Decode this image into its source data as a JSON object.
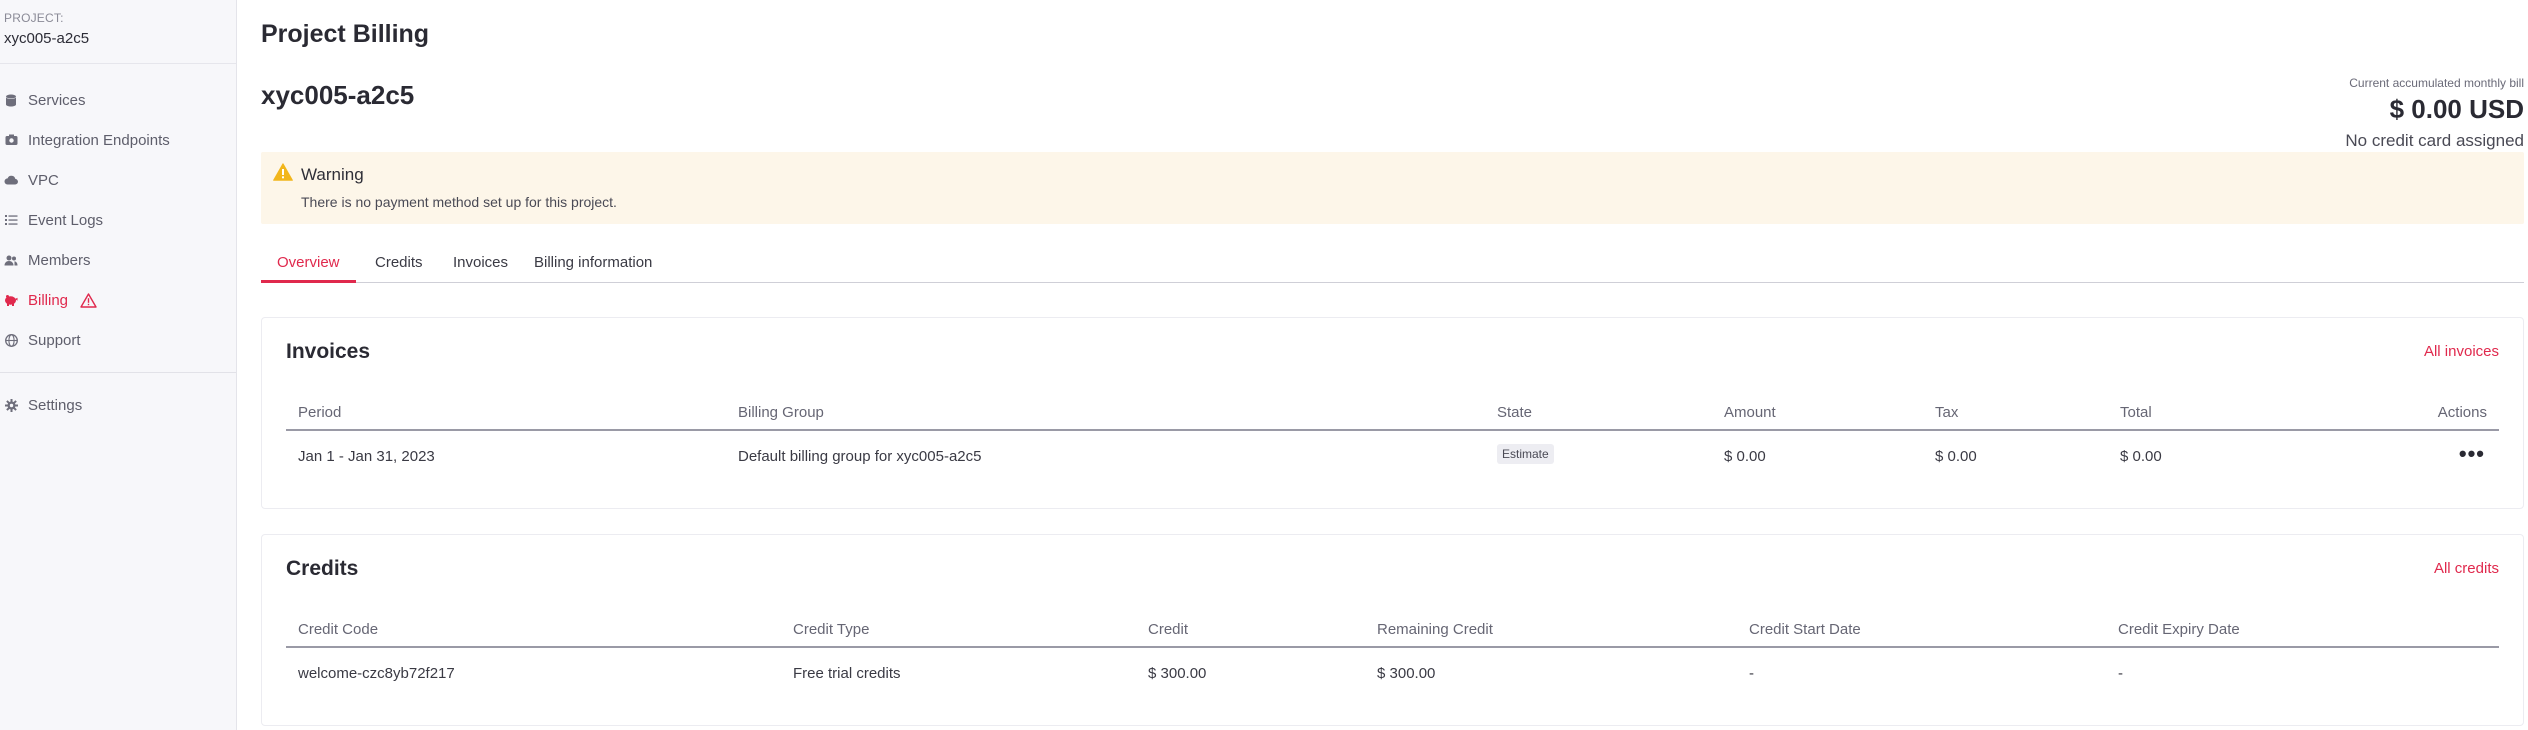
{
  "sidebar": {
    "project_caption": "PROJECT:",
    "project_name": "xyc005-a2c5",
    "items": [
      {
        "label": "Services",
        "icon": "database-icon"
      },
      {
        "label": "Integration Endpoints",
        "icon": "camera-icon"
      },
      {
        "label": "VPC",
        "icon": "cloud-icon"
      },
      {
        "label": "Event Logs",
        "icon": "list-icon"
      },
      {
        "label": "Members",
        "icon": "users-icon"
      },
      {
        "label": "Billing",
        "icon": "piggy-bank-icon",
        "active": true,
        "alert": "warning-triangle-icon"
      },
      {
        "label": "Support",
        "icon": "globe-icon"
      }
    ],
    "settings_label": "Settings"
  },
  "header": {
    "page_title": "Project Billing",
    "project_heading": "xyc005-a2c5"
  },
  "bill": {
    "caption": "Current accumulated monthly bill",
    "amount": "$ 0.00 USD",
    "note": "No credit card assigned"
  },
  "warning": {
    "title": "Warning",
    "text": "There is no payment method set up for this project."
  },
  "tabs": [
    {
      "label": "Overview",
      "active": true
    },
    {
      "label": "Credits"
    },
    {
      "label": "Invoices"
    },
    {
      "label": "Billing information"
    }
  ],
  "invoices": {
    "title": "Invoices",
    "link": "All invoices",
    "columns": [
      "Period",
      "Billing Group",
      "State",
      "Amount",
      "Tax",
      "Total",
      "Actions"
    ],
    "rows": [
      {
        "period": "Jan 1 - Jan 31, 2023",
        "billing_group": "Default billing group for xyc005-a2c5",
        "state": "Estimate",
        "amount": "$ 0.00",
        "tax": "$ 0.00",
        "total": "$ 0.00",
        "actions": "•••"
      }
    ]
  },
  "credits": {
    "title": "Credits",
    "link": "All credits",
    "columns": [
      "Credit Code",
      "Credit Type",
      "Credit",
      "Remaining Credit",
      "Credit Start Date",
      "Credit Expiry Date"
    ],
    "rows": [
      {
        "code": "welcome-czc8yb72f217",
        "type": "Free trial credits",
        "credit": "$ 300.00",
        "remaining": "$ 300.00",
        "start": "-",
        "expiry": "-"
      }
    ]
  },
  "colors": {
    "accent": "#e0294d",
    "warning_bg": "#fdf6e9",
    "warning_icon": "#f2b61c",
    "sidebar_bg": "#f7f7fa"
  }
}
